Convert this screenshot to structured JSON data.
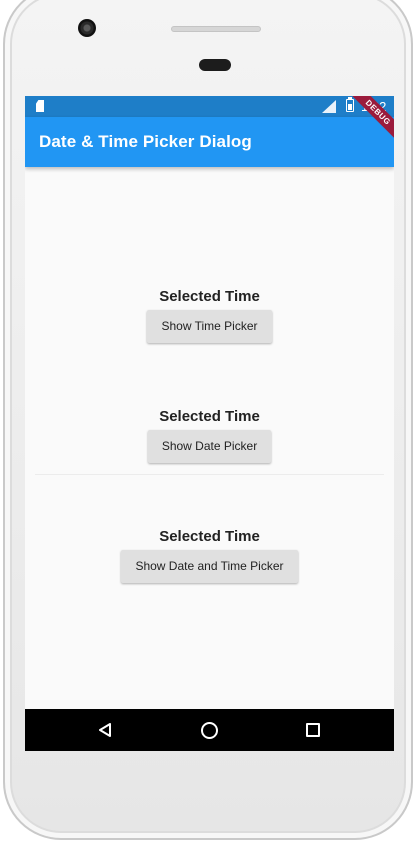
{
  "status_bar": {
    "time": "1:02",
    "debug_label": "DEBUG"
  },
  "app_bar": {
    "title": "Date & Time Picker Dialog"
  },
  "sections": [
    {
      "label": "Selected Time",
      "button_label": "Show Time Picker"
    },
    {
      "label": "Selected Time",
      "button_label": "Show Date Picker"
    },
    {
      "label": "Selected Time",
      "button_label": "Show Date and Time Picker"
    }
  ],
  "colors": {
    "app_bar": "#2196f3",
    "status_bar": "#1e7ec8",
    "debug_banner": "#9b1b3c",
    "button": "#e0e0e0"
  },
  "icons": [
    "sd-card-icon",
    "signal-icon",
    "battery-icon",
    "back-icon",
    "home-icon",
    "recents-icon"
  ]
}
